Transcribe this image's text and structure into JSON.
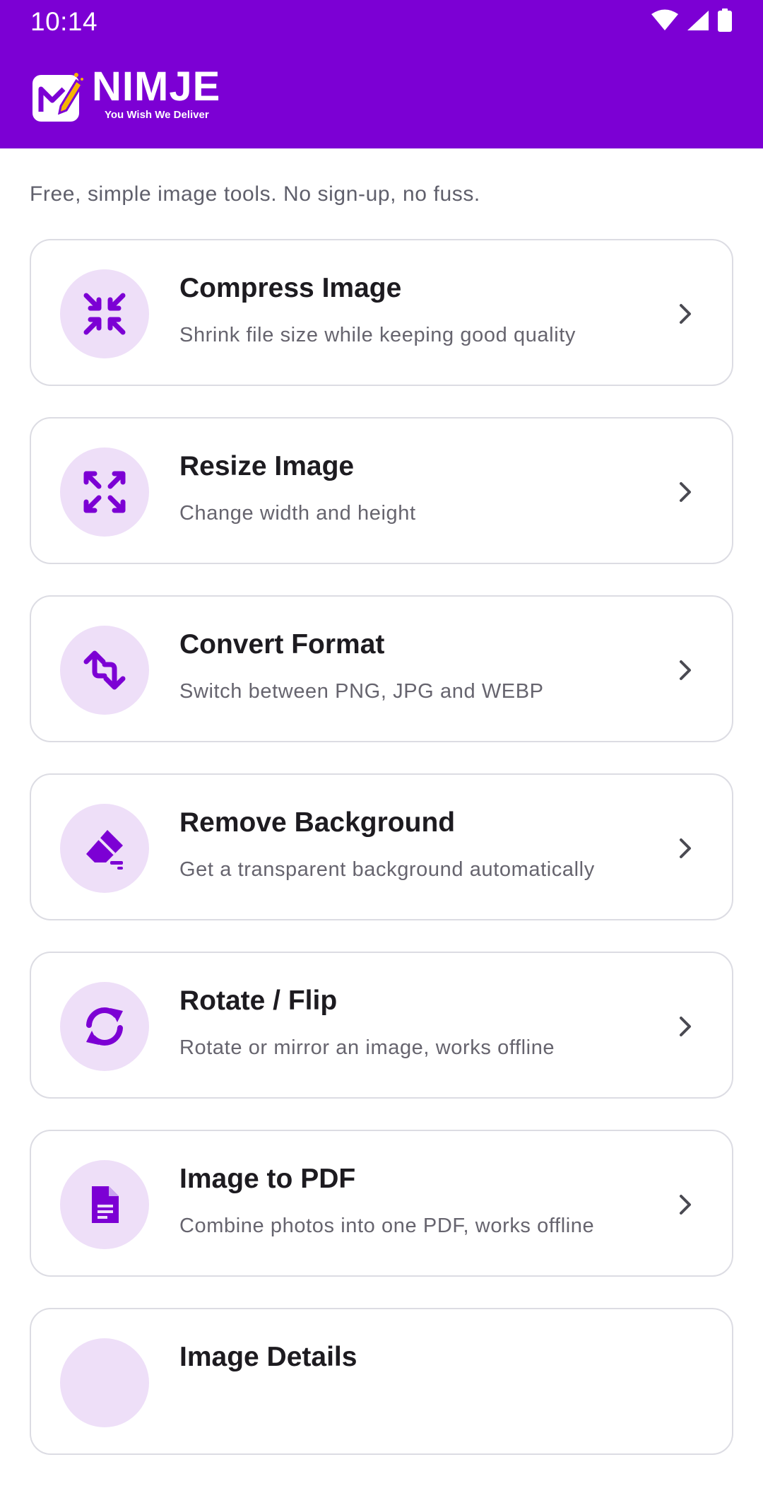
{
  "status_bar": {
    "time": "10:14"
  },
  "header": {
    "logo_text": "NIMJE",
    "logo_tagline": "You Wish We Deliver",
    "background_color": "#7c00d4"
  },
  "tagline": "Free, simple image tools. No sign-up, no fuss.",
  "tools": [
    {
      "title": "Compress Image",
      "subtitle": "Shrink file size while keeping good quality",
      "icon": "compress-icon"
    },
    {
      "title": "Resize Image",
      "subtitle": "Change width and height",
      "icon": "expand-icon"
    },
    {
      "title": "Convert Format",
      "subtitle": "Switch between PNG, JPG and WEBP",
      "icon": "swap-vertical-icon"
    },
    {
      "title": "Remove Background",
      "subtitle": "Get a transparent background automatically",
      "icon": "eraser-icon"
    },
    {
      "title": "Rotate / Flip",
      "subtitle": "Rotate or mirror an image, works offline",
      "icon": "sync-icon"
    },
    {
      "title": "Image to PDF",
      "subtitle": "Combine photos into one PDF, works offline",
      "icon": "document-icon"
    },
    {
      "title": "Image Details",
      "subtitle": "",
      "icon": "info-icon"
    }
  ],
  "colors": {
    "accent": "#7c00d4",
    "icon_bg": "#eedff8",
    "card_border": "#dcdce3"
  }
}
